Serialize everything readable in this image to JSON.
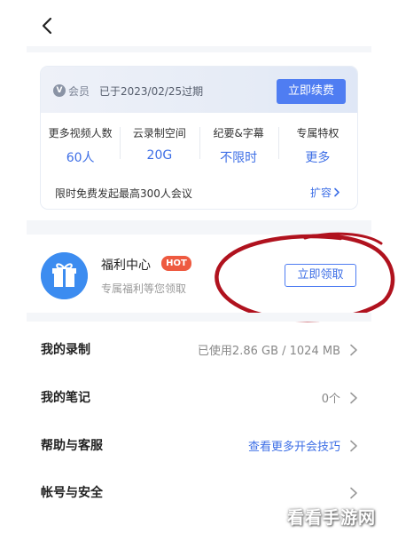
{
  "nav": {
    "back_icon": "chevron-left-icon"
  },
  "membership": {
    "badge_icon": "v-badge-icon",
    "badge_label": "会员",
    "expire_text": "已于2023/02/25过期",
    "renew_label": "立即续费",
    "stats": [
      {
        "label": "更多视频人数",
        "value": "60人"
      },
      {
        "label": "云录制空间",
        "value": "20G"
      },
      {
        "label": "纪要&字幕",
        "value": "不限时"
      },
      {
        "label": "专属特权",
        "value": "更多"
      }
    ],
    "promo_text": "限时免费发起最高300人会议",
    "expand_label": "扩容"
  },
  "welfare": {
    "icon": "gift-icon",
    "title": "福利中心",
    "hot_badge": "HOT",
    "subtitle": "专属福利等您领取",
    "claim_label": "立即领取"
  },
  "menu": [
    {
      "label": "我的录制",
      "value": "已使用2.86 GB / 1024 MB",
      "value_style": "gray"
    },
    {
      "label": "我的笔记",
      "value": "0个",
      "value_style": "gray"
    },
    {
      "label": "帮助与客服",
      "value": "查看更多开会技巧",
      "value_style": "link"
    },
    {
      "label": "帐号与安全",
      "value": "",
      "value_style": "gray"
    }
  ],
  "watermark": "看看手游网",
  "colors": {
    "accent": "#4f7df2",
    "hot": "#ee5a40",
    "annotation": "#b0121e",
    "gift": "#3c8cf0"
  }
}
